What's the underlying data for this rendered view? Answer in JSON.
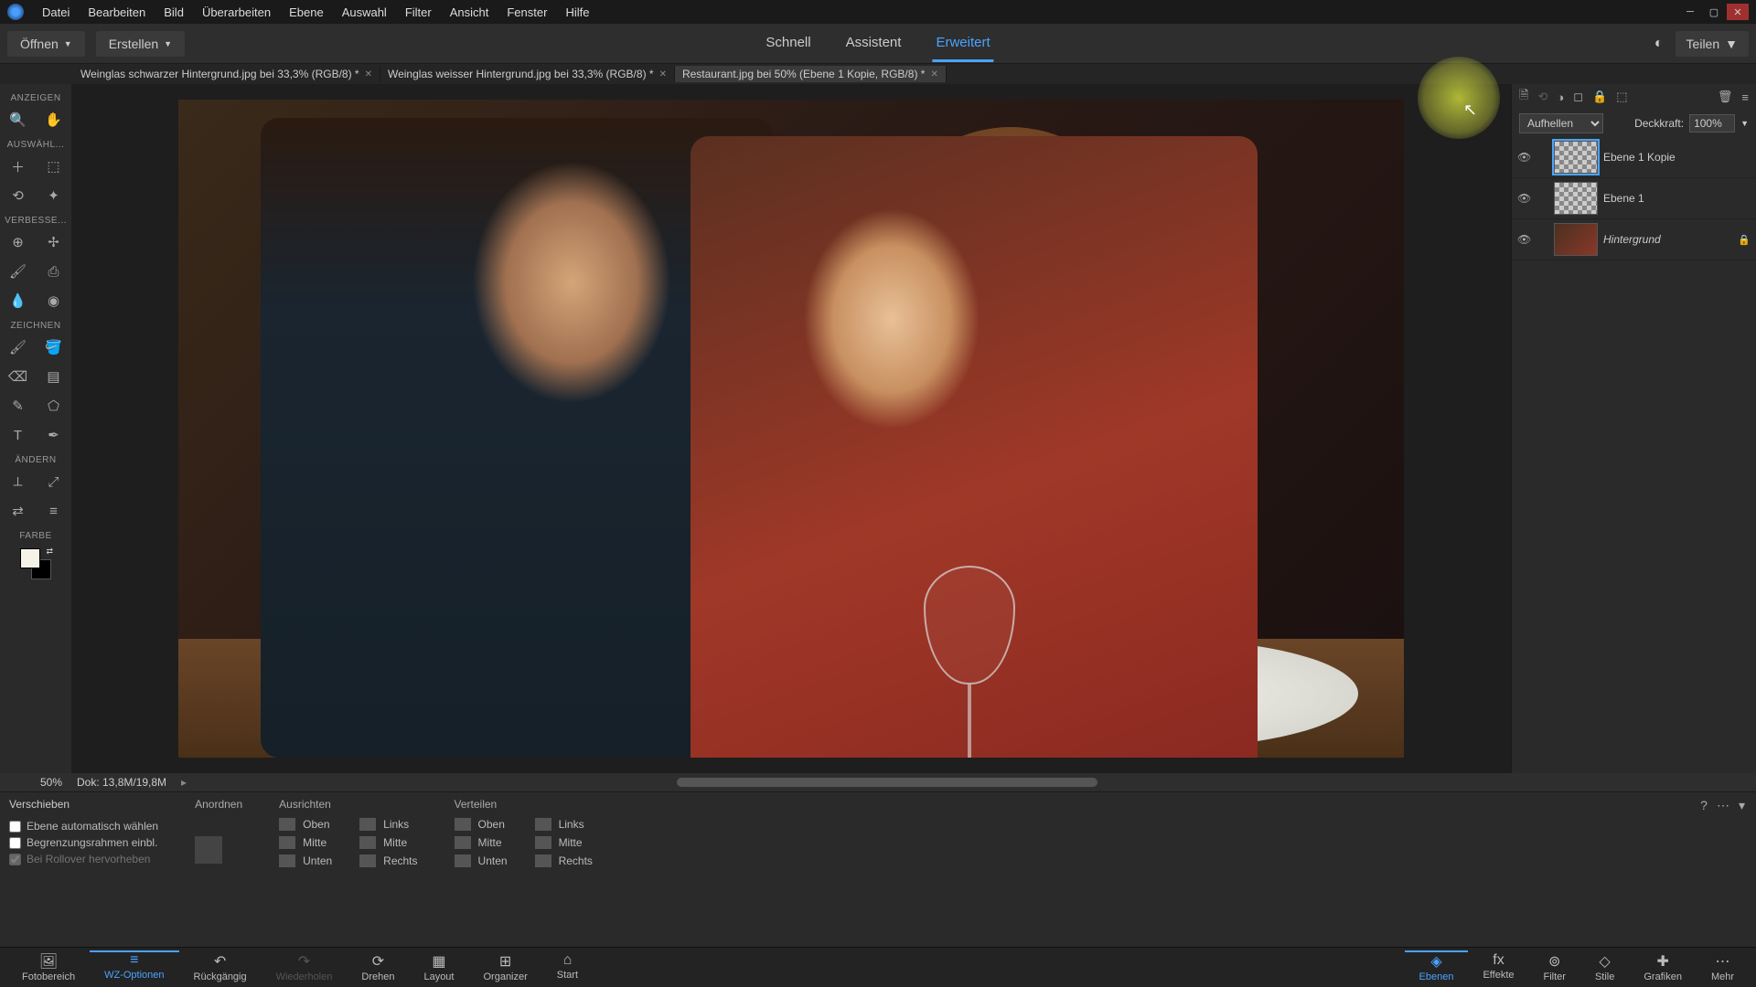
{
  "menubar": [
    "Datei",
    "Bearbeiten",
    "Bild",
    "Überarbeiten",
    "Ebene",
    "Auswahl",
    "Filter",
    "Ansicht",
    "Fenster",
    "Hilfe"
  ],
  "topbar": {
    "open": "Öffnen",
    "create": "Erstellen",
    "modes": [
      "Schnell",
      "Assistent",
      "Erweitert"
    ],
    "active_mode": 2,
    "share": "Teilen"
  },
  "doctabs": [
    {
      "label": "Weinglas schwarzer Hintergrund.jpg bei 33,3% (RGB/8) *",
      "active": false
    },
    {
      "label": "Weinglas weisser Hintergrund.jpg bei 33,3% (RGB/8) *",
      "active": false
    },
    {
      "label": "Restaurant.jpg bei 50% (Ebene 1 Kopie, RGB/8) *",
      "active": true
    }
  ],
  "tools": {
    "sections": [
      {
        "label": "ANZEIGEN",
        "rows": [
          [
            "zoom-icon",
            "hand-icon"
          ]
        ]
      },
      {
        "label": "AUSWÄHL...",
        "rows": [
          [
            "add-icon",
            "marquee-icon"
          ],
          [
            "lasso-icon",
            "wand-icon"
          ]
        ]
      },
      {
        "label": "VERBESSE...",
        "rows": [
          [
            "redeye-icon",
            "spot-icon"
          ],
          [
            "brush-heal-icon",
            "stamp-icon"
          ],
          [
            "blur-icon",
            "sponge-icon"
          ]
        ]
      },
      {
        "label": "ZEICHNEN",
        "rows": [
          [
            "brush-icon",
            "bucket-icon"
          ],
          [
            "eraser-icon",
            "gradient-icon"
          ],
          [
            "pencil-icon",
            "shape-icon"
          ],
          [
            "type-icon",
            "pen-icon"
          ]
        ]
      },
      {
        "label": "ÄNDERN",
        "rows": [
          [
            "crop-icon",
            "transform-icon"
          ],
          [
            "shuffle-icon",
            "align-icon"
          ]
        ]
      },
      {
        "label": "FARBE",
        "rows": []
      }
    ]
  },
  "layers": {
    "blend_label": "Aufhellen",
    "opacity_label": "Deckkraft:",
    "opacity_value": "100%",
    "items": [
      {
        "name": "Ebene 1 Kopie",
        "selected": true,
        "visible": true,
        "type": "transparent"
      },
      {
        "name": "Ebene 1",
        "selected": false,
        "visible": true,
        "type": "transparent"
      },
      {
        "name": "Hintergrund",
        "selected": false,
        "visible": true,
        "type": "image",
        "italic": true,
        "locked": true
      }
    ]
  },
  "status": {
    "zoom": "50%",
    "doc": "Dok: 13,8M/19,8M"
  },
  "options": {
    "tool": "Verschieben",
    "checks": [
      {
        "label": "Ebene automatisch wählen",
        "checked": false,
        "enabled": true
      },
      {
        "label": "Begrenzungsrahmen einbl.",
        "checked": false,
        "enabled": true
      },
      {
        "label": "Bei Rollover hervorheben",
        "checked": true,
        "enabled": false
      }
    ],
    "arrange": "Anordnen",
    "align": {
      "heading": "Ausrichten",
      "col1": [
        "Oben",
        "Mitte",
        "Unten"
      ],
      "col2": [
        "Links",
        "Mitte",
        "Rechts"
      ]
    },
    "distribute": {
      "heading": "Verteilen",
      "col1": [
        "Oben",
        "Mitte",
        "Unten"
      ],
      "col2": [
        "Links",
        "Mitte",
        "Rechts"
      ]
    }
  },
  "bottom_left": [
    {
      "label": "Fotobereich",
      "icon": "image-stack-icon"
    },
    {
      "label": "WZ-Optionen",
      "icon": "options-icon",
      "active": true
    },
    {
      "label": "Rückgängig",
      "icon": "undo-icon"
    },
    {
      "label": "Wiederholen",
      "icon": "redo-icon",
      "disabled": true
    },
    {
      "label": "Drehen",
      "icon": "rotate-icon"
    },
    {
      "label": "Layout",
      "icon": "layout-icon"
    },
    {
      "label": "Organizer",
      "icon": "organizer-icon"
    },
    {
      "label": "Start",
      "icon": "home-icon"
    }
  ],
  "bottom_right": [
    {
      "label": "Ebenen",
      "icon": "layers-icon",
      "active": true
    },
    {
      "label": "Effekte",
      "icon": "fx-icon"
    },
    {
      "label": "Filter",
      "icon": "filter-icon"
    },
    {
      "label": "Stile",
      "icon": "styles-icon"
    },
    {
      "label": "Grafiken",
      "icon": "graphics-icon"
    },
    {
      "label": "Mehr",
      "icon": "more-icon"
    }
  ]
}
